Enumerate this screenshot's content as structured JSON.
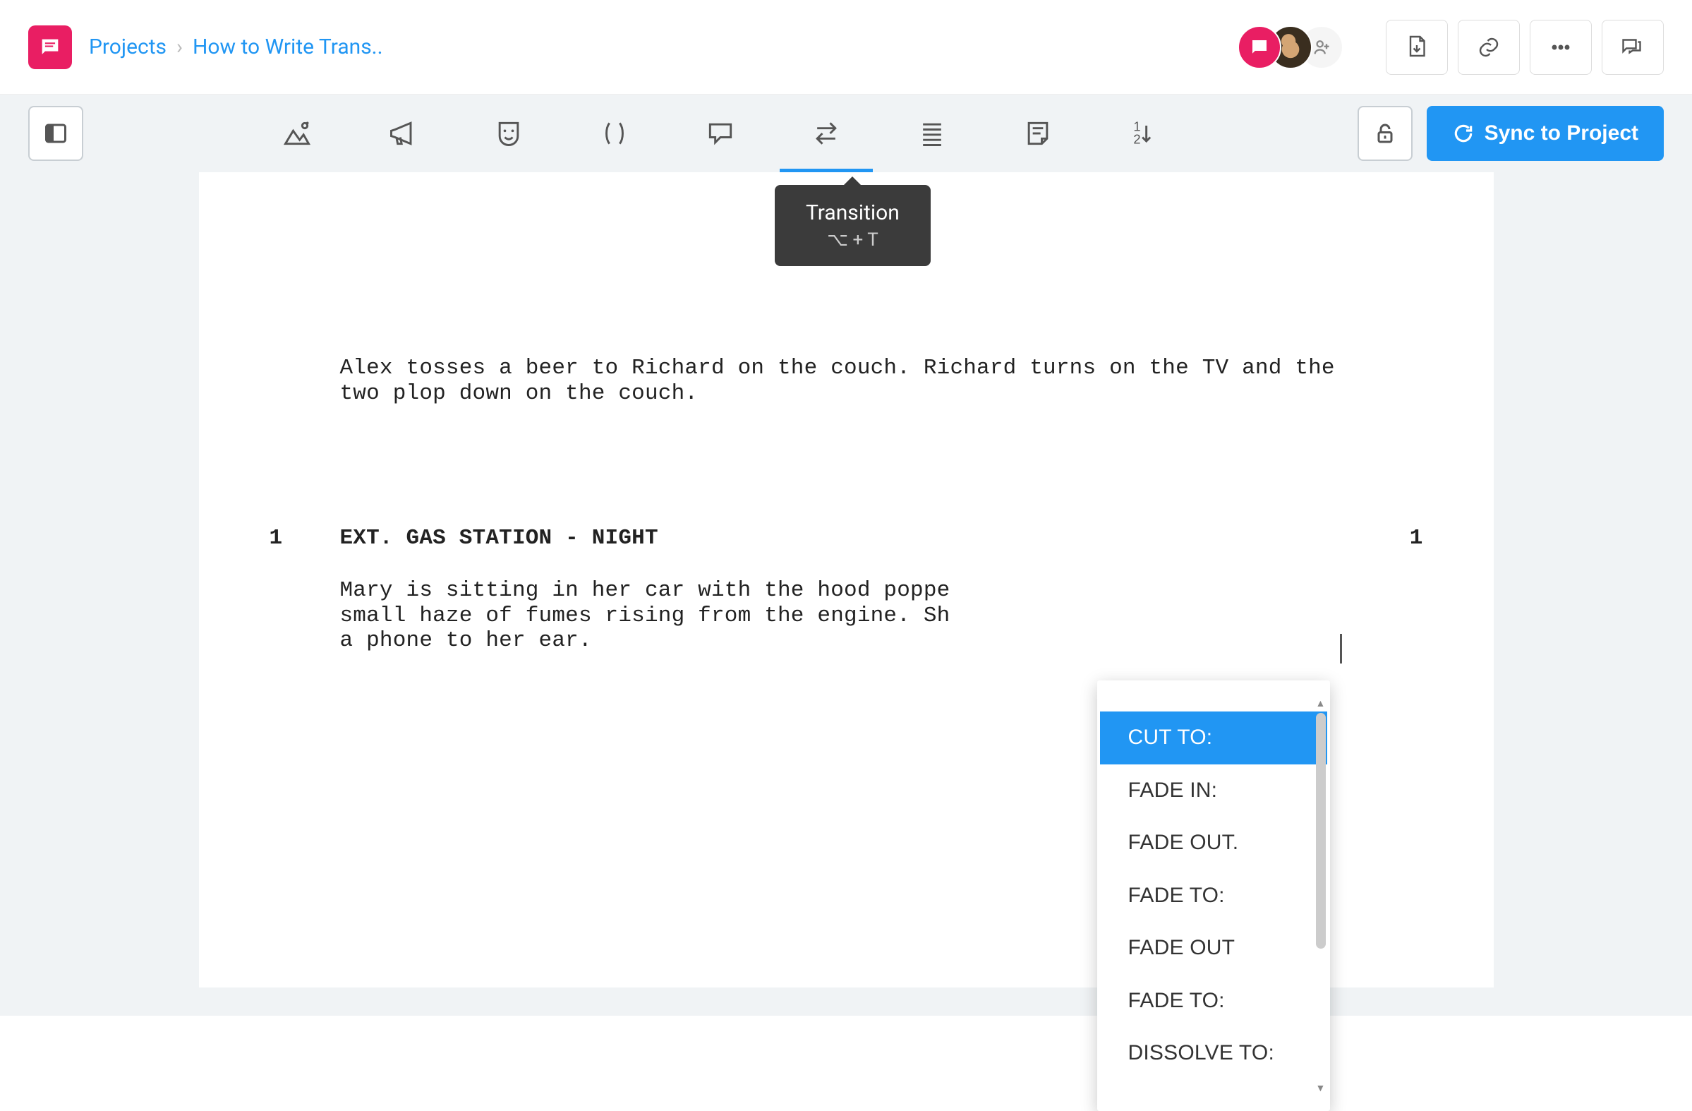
{
  "breadcrumb": {
    "root": "Projects",
    "current": "How to Write Trans.."
  },
  "toolbar": {
    "sync_label": "Sync to Project"
  },
  "tooltip": {
    "title": "Transition",
    "shortcut": "⌥ + T"
  },
  "script": {
    "action1": "Alex tosses a beer to Richard on the couch. Richard turns on the TV and the two plop down on the couch.",
    "scene1_num_left": "1",
    "scene1_heading": "EXT. GAS STATION - NIGHT",
    "scene1_num_right": "1",
    "action2_l1": "Mary is sitting in her car with the hood poppe",
    "action2_l2": "small haze of fumes rising from the engine. Sh",
    "action2_l3": "a phone to her ear."
  },
  "transitions": [
    "CUT TO:",
    "FADE IN:",
    "FADE OUT.",
    "FADE TO:",
    "FADE OUT",
    "FADE TO:",
    "DISSOLVE TO:"
  ]
}
